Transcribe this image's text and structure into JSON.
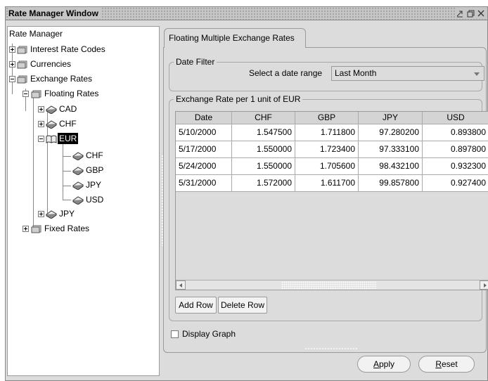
{
  "window": {
    "title": "Rate Manager Window",
    "controls": [
      "minimize-icon",
      "maximize-icon",
      "close-icon"
    ]
  },
  "tree": {
    "root": "Rate Manager",
    "nodes": [
      {
        "label": "Interest Rate Codes",
        "icon": "folder-icon",
        "expander": "plus"
      },
      {
        "label": "Currencies",
        "icon": "folder-icon",
        "expander": "plus"
      },
      {
        "label": "Exchange Rates",
        "icon": "folder-icon",
        "expander": "minus"
      },
      {
        "label": "Floating Rates",
        "icon": "folder-icon",
        "expander": "minus"
      },
      {
        "label": "CAD",
        "icon": "currency-icon",
        "expander": "plus"
      },
      {
        "label": "CHF",
        "icon": "currency-icon",
        "expander": "plus"
      },
      {
        "label": "EUR",
        "icon": "open-book-icon",
        "expander": "minus",
        "selected": true
      },
      {
        "label": "CHF",
        "icon": "currency-icon"
      },
      {
        "label": "GBP",
        "icon": "currency-icon"
      },
      {
        "label": "JPY",
        "icon": "currency-icon"
      },
      {
        "label": "USD",
        "icon": "currency-icon"
      },
      {
        "label": "JPY",
        "icon": "currency-icon",
        "expander": "plus"
      },
      {
        "label": "Fixed Rates",
        "icon": "folder-icon",
        "expander": "plus"
      }
    ]
  },
  "tab": {
    "label": "Floating Multiple Exchange Rates"
  },
  "date_filter": {
    "group_label": "Date Filter",
    "range_label": "Select a date range",
    "range_value": "Last Month"
  },
  "rates": {
    "group_label": "Exchange Rate per 1 unit of EUR",
    "columns": [
      "Date",
      "CHF",
      "GBP",
      "JPY",
      "USD"
    ],
    "rows": [
      [
        "5/10/2000",
        "1.547500",
        "1.711800",
        "97.280200",
        "0.893800"
      ],
      [
        "5/17/2000",
        "1.550000",
        "1.723400",
        "97.333100",
        "0.897800"
      ],
      [
        "5/24/2000",
        "1.550000",
        "1.705600",
        "98.432100",
        "0.932300"
      ],
      [
        "5/31/2000",
        "1.572000",
        "1.611700",
        "99.857800",
        "0.927400"
      ]
    ],
    "add_row": "Add Row",
    "delete_row": "Delete Row"
  },
  "display_graph": {
    "label": "Display Graph",
    "checked": false
  },
  "buttons": {
    "apply": "Apply",
    "reset": "Reset"
  },
  "colors": {
    "selected_bg": "#000000",
    "window_bg": "#dcdcdc"
  }
}
